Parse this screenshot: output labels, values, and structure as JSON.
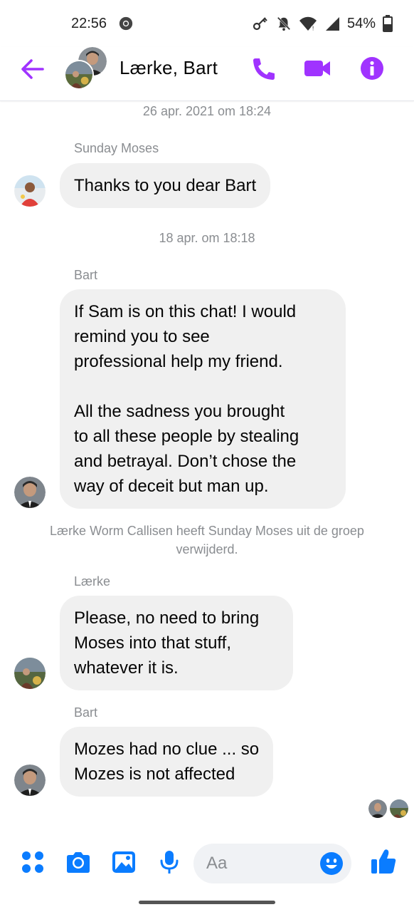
{
  "status_bar": {
    "time": "22:56",
    "battery": "54%"
  },
  "header": {
    "title": "Lærke, Bart"
  },
  "messages": [
    {
      "type": "timestamp",
      "text": "26 apr. 2021 om 18:24"
    },
    {
      "type": "message",
      "sender": "Sunday Moses",
      "text": "Thanks to you dear Bart"
    },
    {
      "type": "timestamp",
      "text": "18 apr. om 18:18"
    },
    {
      "type": "message",
      "sender": "Bart",
      "text": "If Sam is on this chat! I would\nremind you to see\nprofessional help my friend.\n\nAll the sadness you brought\nto all these people by stealing\nand betrayal. Don’t chose the\nway of deceit but man up."
    },
    {
      "type": "system",
      "text": "Lærke Worm Callisen heeft Sunday Moses uit de groep verwijderd."
    },
    {
      "type": "message",
      "sender": "Lærke",
      "text": "Please, no need to bring\nMoses into that stuff,\nwhatever it is."
    },
    {
      "type": "message",
      "sender": "Bart",
      "text": "Mozes had no clue ... so\nMozes is not affected"
    }
  ],
  "composer": {
    "placeholder": "Aa"
  },
  "colors": {
    "accent": "#a033ff",
    "messenger_blue": "#0a7cff",
    "bubble": "#f0f0f0",
    "meta_text": "#8a8d91"
  },
  "icons": {
    "header": [
      "back-arrow-icon",
      "phone-icon",
      "video-camera-icon",
      "info-icon"
    ],
    "composer": [
      "apps-icon",
      "camera-icon",
      "image-icon",
      "microphone-icon",
      "emoji-icon",
      "thumbs-up-icon"
    ]
  }
}
